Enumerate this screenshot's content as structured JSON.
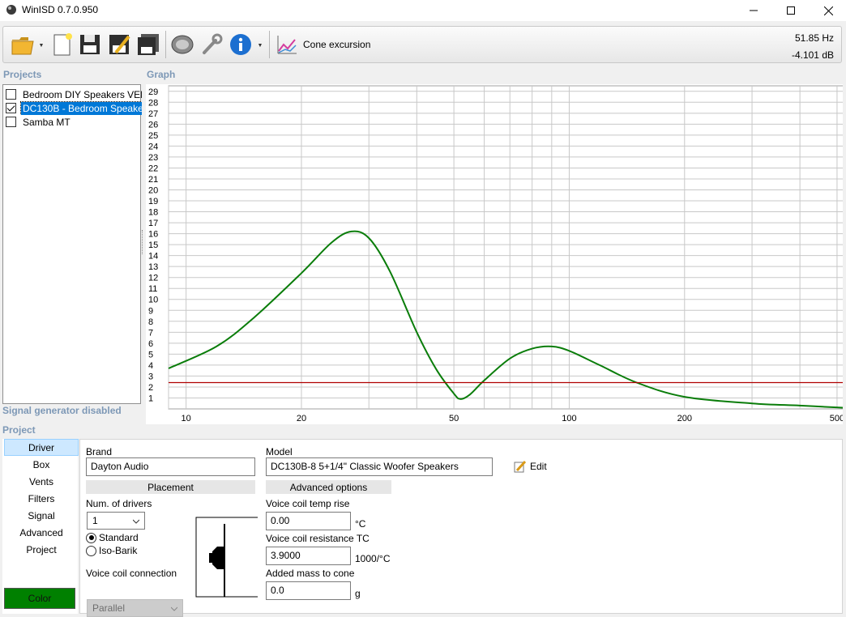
{
  "window": {
    "title": "WinISD 0.7.0.950"
  },
  "toolbar": {
    "cone_label": "Cone excursion",
    "readout_freq": "51.85 Hz",
    "readout_db": "-4.101 dB"
  },
  "projects": {
    "header": "Projects",
    "items": [
      {
        "label": "Bedroom DIY Speakers VEN",
        "checked": false
      },
      {
        "label": "DC130B - Bedroom Speake",
        "checked": true,
        "selected": true
      },
      {
        "label": "Samba MT",
        "checked": false
      }
    ]
  },
  "graph": {
    "header": "Graph"
  },
  "signal_status": "Signal generator disabled",
  "project_header": "Project",
  "nav": {
    "items": [
      "Driver",
      "Box",
      "Vents",
      "Filters",
      "Signal",
      "Advanced",
      "Project"
    ],
    "color_button": "Color"
  },
  "driver": {
    "brand_label": "Brand",
    "brand_value": "Dayton Audio",
    "model_label": "Model",
    "model_value": "DC130B-8 5+1/4\" Classic Woofer Speakers",
    "edit_label": "Edit",
    "placement_header": "Placement",
    "num_drivers_label": "Num. of drivers",
    "num_drivers_value": "1",
    "standard_label": "Standard",
    "isobarik_label": "Iso-Barik",
    "vc_connection_label": "Voice coil connection",
    "vc_connection_value": "Parallel",
    "advanced_header": "Advanced options",
    "vc_temp_label": "Voice coil temp rise",
    "vc_temp_value": "0.00",
    "vc_temp_unit": "°C",
    "vc_res_label": "Voice coil resistance TC",
    "vc_res_value": "3.9000",
    "vc_res_unit": "1000/°C",
    "mass_label": "Added mass to cone",
    "mass_value": "0.0",
    "mass_unit": "g"
  },
  "chart_data": {
    "type": "line",
    "xscale": "log",
    "xlim": [
      9,
      520
    ],
    "ylim": [
      0,
      29.5
    ],
    "x_tick_labels": [
      "10",
      "20",
      "50",
      "100",
      "200",
      "500"
    ],
    "y_tick_labels": [
      "1",
      "2",
      "3",
      "4",
      "5",
      "6",
      "7",
      "8",
      "9",
      "10",
      "11",
      "12",
      "13",
      "14",
      "15",
      "16",
      "17",
      "18",
      "19",
      "20",
      "21",
      "22",
      "23",
      "24",
      "25",
      "26",
      "27",
      "28",
      "29"
    ],
    "grid": true,
    "series": [
      {
        "color": "#0a7d0a",
        "x": [
          9,
          12,
          15,
          20,
          24,
          27,
          30,
          34,
          40,
          45,
          50,
          52,
          55,
          60,
          70,
          80,
          90,
          100,
          120,
          150,
          200,
          300,
          400,
          520
        ],
        "y": [
          3.7,
          5.7,
          8.3,
          12.4,
          15.2,
          16.2,
          15.6,
          12.6,
          7.0,
          3.6,
          1.4,
          0.9,
          1.3,
          2.6,
          4.6,
          5.5,
          5.7,
          5.3,
          4.0,
          2.4,
          1.1,
          0.5,
          0.3,
          0.1
        ]
      },
      {
        "color": "#b00000",
        "x": [
          9,
          520
        ],
        "y": [
          2.4,
          2.4
        ]
      }
    ]
  },
  "colors": {
    "accent": "#0078d7",
    "graph_line": "#0a7d0a",
    "reference_line": "#b00000",
    "color_button": "#008000",
    "section_label": "#7d98b6"
  }
}
